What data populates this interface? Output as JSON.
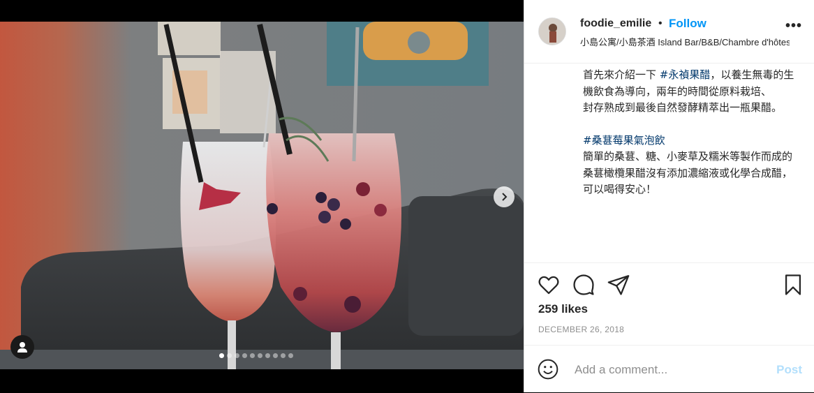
{
  "post": {
    "username": "foodie_emilie",
    "separator": "•",
    "follow_label": "Follow",
    "location": "小島公寓/小島茶酒 Island Bar/B&B/Chambre d'hôtes",
    "more_label": "•••",
    "likes": "259 likes",
    "date": "DECEMBER 26, 2018"
  },
  "caption": {
    "l1_pre": "首先來介紹一下 ",
    "l1_tag": "#永禎果醋",
    "l1_post": "，以養生無毒的生機飲食為導向，兩年的時間從原料栽培、",
    "l2": "封存熟成到最後自然發酵精萃出一瓶果醋。",
    "tag2": "#桑葚莓果氣泡飲",
    "l3": "簡單的桑葚、糖、小麥草及糯米等製作而成的",
    "l4": "桑葚橄欖果醋沒有添加濃縮液或化學合成醋，",
    "l5": "可以喝得安心！"
  },
  "comment": {
    "placeholder": "Add a comment...",
    "post_label": "Post"
  },
  "carousel": {
    "slide_count": 10,
    "active_index": 0
  },
  "icons": [
    "heart-icon",
    "comment-icon",
    "share-icon",
    "bookmark-icon",
    "emoji-icon",
    "chevron-right-icon",
    "user-tag-icon"
  ]
}
